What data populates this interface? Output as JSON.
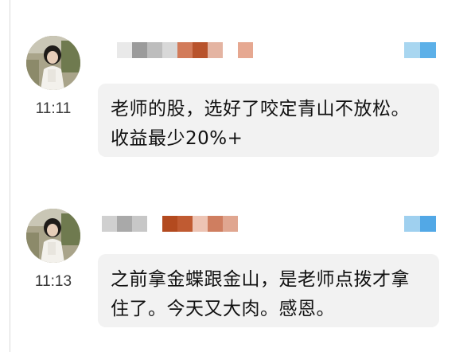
{
  "messages": [
    {
      "time": "11:11",
      "text": "老师的股，选好了咬定青山不放松。收益最少20%+",
      "name_blur_colors": [
        "#ffffff",
        "#e9e9e9",
        "#9b9b9b",
        "#bdbdbd",
        "#d8d8d8",
        "#d27b5a",
        "#b8532c",
        "#e4b4a2",
        "#ffffff",
        "#e6a891"
      ],
      "side_blur_colors": [
        "#a8d6f0",
        "#5cb0e8"
      ]
    },
    {
      "time": "11:13",
      "text": "之前拿金蝶跟金山，是老师点拨才拿住了。今天又大肉。感恩。",
      "name_blur_colors": [
        "#d0d0d0",
        "#a9a9a9",
        "#c7c7c7",
        "#ffffff",
        "#b34a1f",
        "#c05b32",
        "#edc4b4",
        "#cf7e60",
        "#e0a690"
      ],
      "side_blur_colors": [
        "#9fd0ef",
        "#52a8e6"
      ]
    }
  ]
}
